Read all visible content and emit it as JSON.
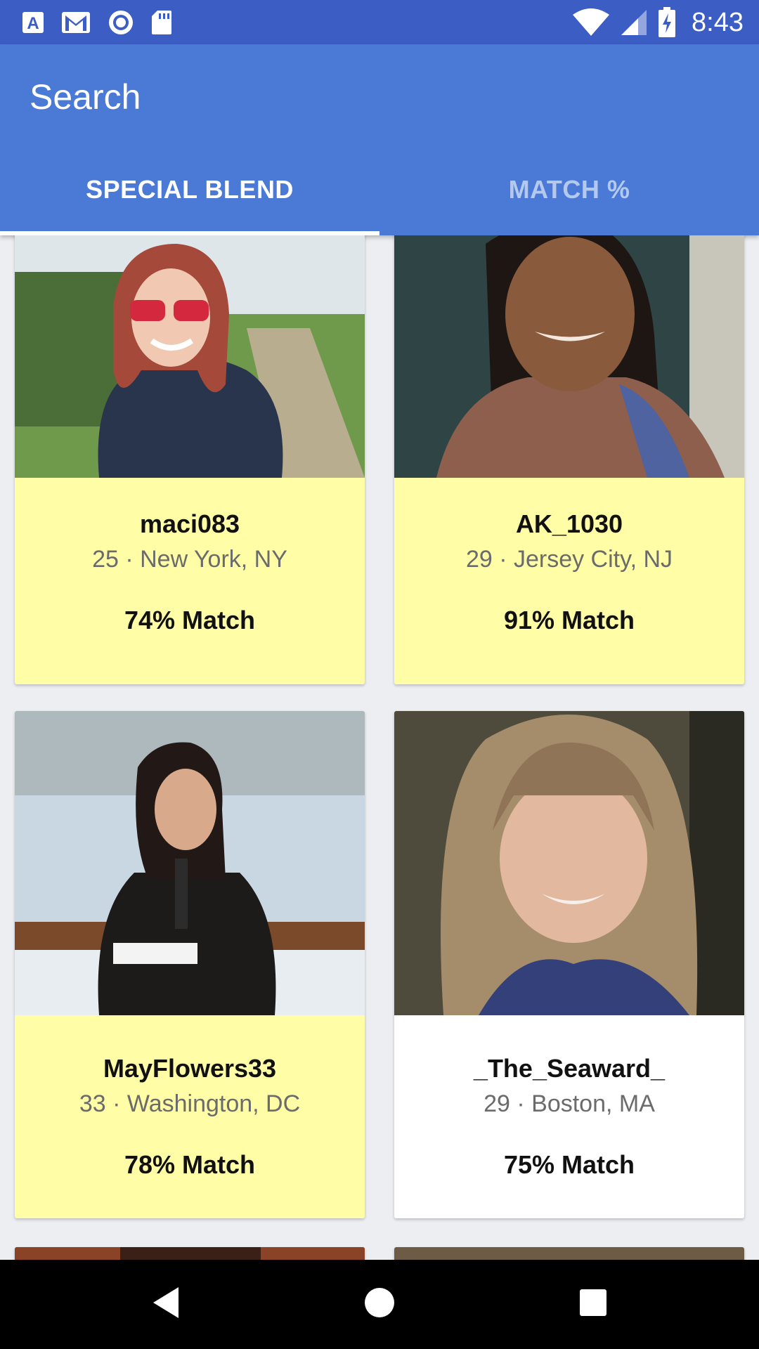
{
  "status_bar": {
    "time": "8:43",
    "left_icons": [
      "font-a-icon",
      "gmail-icon",
      "record-icon",
      "sd-card-icon"
    ],
    "right_icons": [
      "wifi-icon",
      "cell-signal-icon",
      "battery-charging-icon"
    ]
  },
  "app_bar": {
    "title": "Search",
    "tabs": [
      {
        "label": "SPECIAL BLEND",
        "active": true
      },
      {
        "label": "MATCH %",
        "active": false
      }
    ]
  },
  "profiles": [
    {
      "name": "maci083",
      "meta": "25 · New York, NY",
      "match": "74% Match",
      "highlight": true
    },
    {
      "name": "AK_1030",
      "meta": "29 · Jersey City, NJ",
      "match": "91% Match",
      "highlight": true
    },
    {
      "name": "MayFlowers33",
      "meta": "33 · Washington, DC",
      "match": "78% Match",
      "highlight": true
    },
    {
      "name": "_The_Seaward_",
      "meta": "29 · Boston, MA",
      "match": "75% Match",
      "highlight": false
    }
  ],
  "colors": {
    "status_bar": "#3b5dc4",
    "app_bar": "#4a7ad6",
    "card_highlight": "#fffda6",
    "card_plain": "#ffffff"
  },
  "nav_bar": {
    "icons": [
      "back-icon",
      "home-icon",
      "recents-icon"
    ]
  }
}
